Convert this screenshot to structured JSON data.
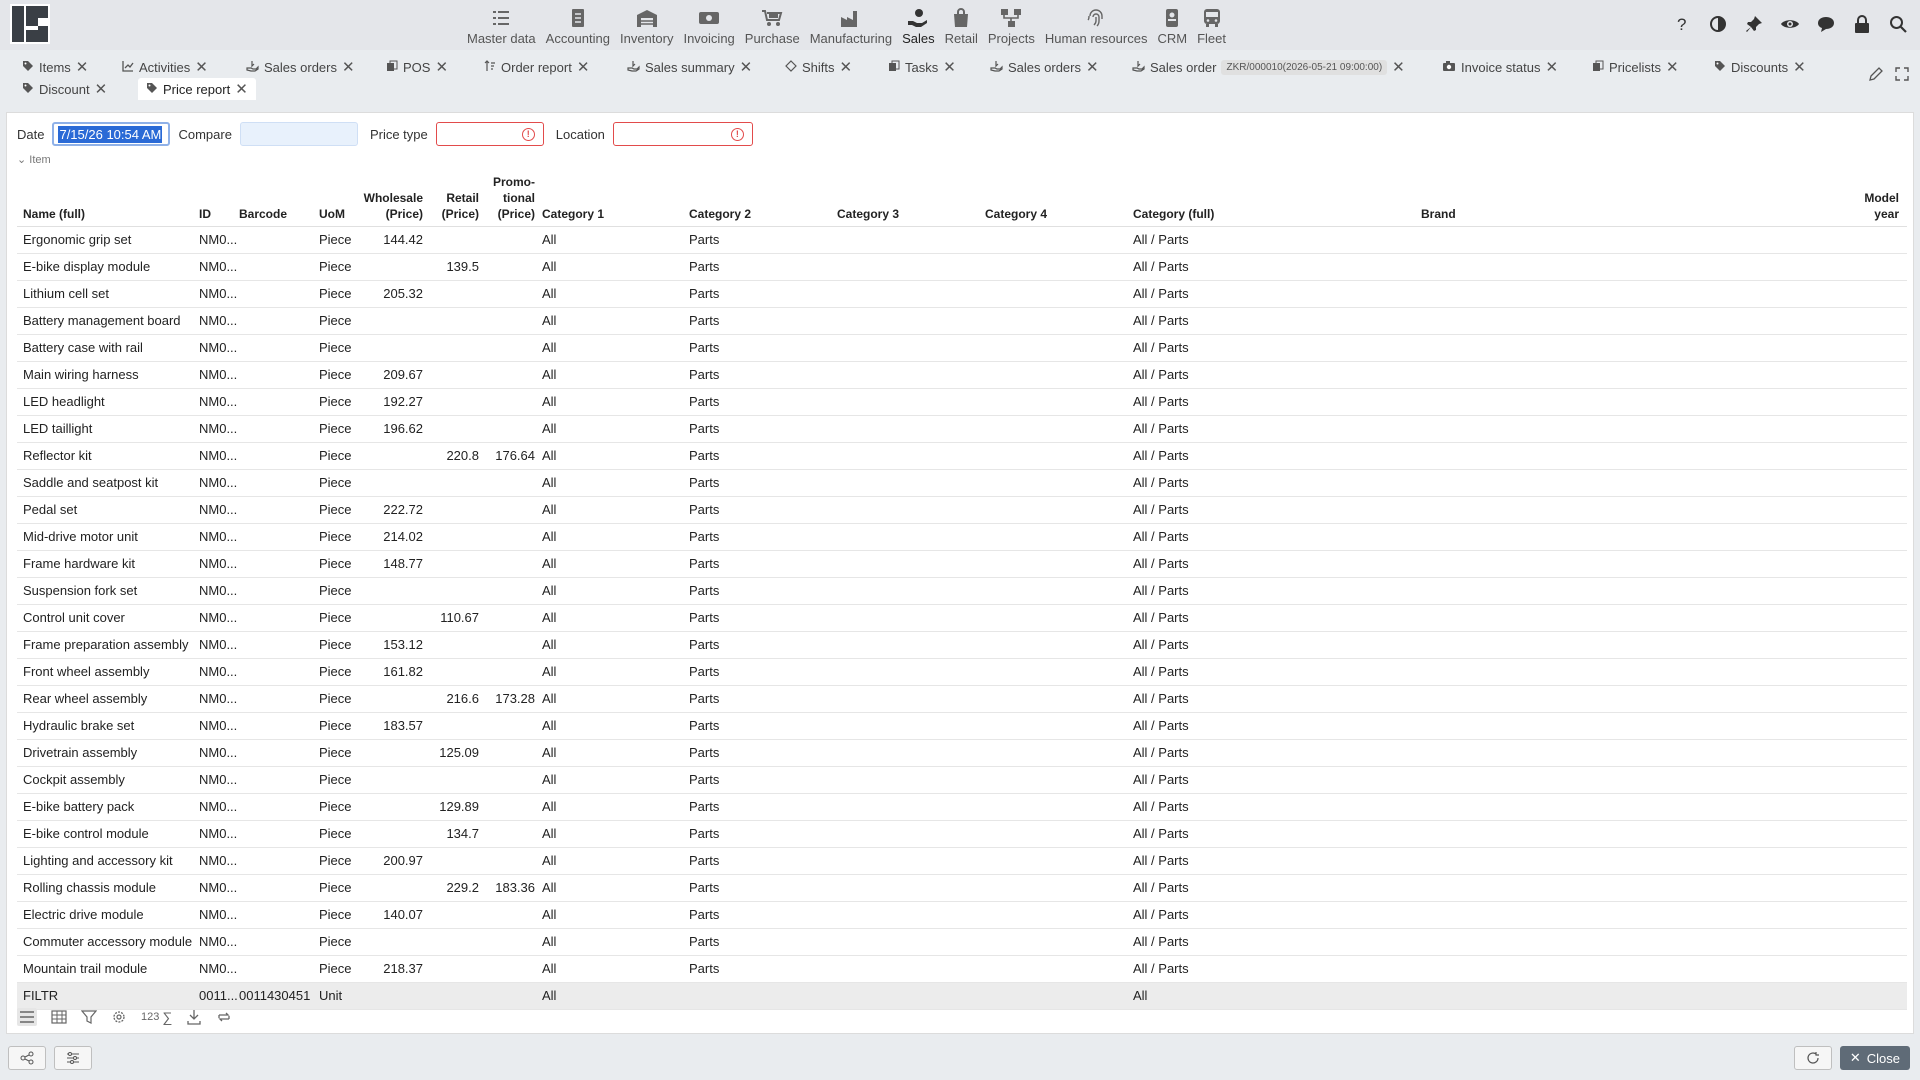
{
  "modules": [
    {
      "label": "Master data",
      "icon": "list-icon"
    },
    {
      "label": "Accounting",
      "icon": "ledger-icon"
    },
    {
      "label": "Inventory",
      "icon": "warehouse-icon"
    },
    {
      "label": "Invoicing",
      "icon": "cash-icon"
    },
    {
      "label": "Purchase",
      "icon": "cart-icon"
    },
    {
      "label": "Manufacturing",
      "icon": "factory-icon"
    },
    {
      "label": "Sales",
      "icon": "hand-coin-icon"
    },
    {
      "label": "Retail",
      "icon": "bag-icon"
    },
    {
      "label": "Projects",
      "icon": "network-icon"
    },
    {
      "label": "Human resources",
      "icon": "fingerprint-icon"
    },
    {
      "label": "CRM",
      "icon": "phone-icon"
    },
    {
      "label": "Fleet",
      "icon": "bus-icon"
    }
  ],
  "active_module": "Sales",
  "tabs": [
    {
      "label": "Items"
    },
    {
      "label": "Activities"
    },
    {
      "label": "Sales orders"
    },
    {
      "label": "POS"
    },
    {
      "label": "Order report"
    },
    {
      "label": "Sales summary"
    },
    {
      "label": "Shifts"
    },
    {
      "label": "Tasks"
    },
    {
      "label": "Sales orders"
    },
    {
      "label": "Sales order",
      "badge": "ZKR/000010(2026-05-21 09:00:00)"
    },
    {
      "label": "Invoice status"
    },
    {
      "label": "Pricelists"
    },
    {
      "label": "Discounts"
    },
    {
      "label": "Discount"
    },
    {
      "label": "Price report"
    }
  ],
  "filters": {
    "date_label": "Date",
    "date_value": "7/15/26 10:54 AM",
    "compare_label": "Compare",
    "price_type_label": "Price type",
    "location_label": "Location",
    "group_label": "Item"
  },
  "columns": [
    "Name (full)",
    "ID",
    "Barcode",
    "UoM",
    "Wholesale (Price)",
    "Retail (Price)",
    "Promo-tional (Price)",
    "Category 1",
    "Category 2",
    "Category 3",
    "Category 4",
    "Category (full)",
    "Brand",
    "Model year"
  ],
  "column_lines": {
    "wholesale": [
      "Wholesale",
      "(Price)"
    ],
    "retail": [
      "Retail",
      "(Price)"
    ],
    "promo": [
      "Promo-",
      "tional",
      "(Price)"
    ]
  },
  "rows": [
    {
      "name": "Ergonomic grip set",
      "id": "NM0...",
      "barcode": "",
      "uom": "Piece",
      "wholesale": "144.42",
      "retail": "",
      "promo": "",
      "cat1": "All",
      "cat2": "Parts",
      "catfull": "All / Parts"
    },
    {
      "name": "E-bike display module",
      "id": "NM0...",
      "barcode": "",
      "uom": "Piece",
      "wholesale": "",
      "retail": "139.5",
      "promo": "",
      "cat1": "All",
      "cat2": "Parts",
      "catfull": "All / Parts"
    },
    {
      "name": "Lithium cell set",
      "id": "NM0...",
      "barcode": "",
      "uom": "Piece",
      "wholesale": "205.32",
      "retail": "",
      "promo": "",
      "cat1": "All",
      "cat2": "Parts",
      "catfull": "All / Parts"
    },
    {
      "name": "Battery management board",
      "id": "NM0...",
      "barcode": "",
      "uom": "Piece",
      "wholesale": "",
      "retail": "",
      "promo": "",
      "cat1": "All",
      "cat2": "Parts",
      "catfull": "All / Parts"
    },
    {
      "name": "Battery case with rail",
      "id": "NM0...",
      "barcode": "",
      "uom": "Piece",
      "wholesale": "",
      "retail": "",
      "promo": "",
      "cat1": "All",
      "cat2": "Parts",
      "catfull": "All / Parts"
    },
    {
      "name": "Main wiring harness",
      "id": "NM0...",
      "barcode": "",
      "uom": "Piece",
      "wholesale": "209.67",
      "retail": "",
      "promo": "",
      "cat1": "All",
      "cat2": "Parts",
      "catfull": "All / Parts"
    },
    {
      "name": "LED headlight",
      "id": "NM0...",
      "barcode": "",
      "uom": "Piece",
      "wholesale": "192.27",
      "retail": "",
      "promo": "",
      "cat1": "All",
      "cat2": "Parts",
      "catfull": "All / Parts"
    },
    {
      "name": "LED taillight",
      "id": "NM0...",
      "barcode": "",
      "uom": "Piece",
      "wholesale": "196.62",
      "retail": "",
      "promo": "",
      "cat1": "All",
      "cat2": "Parts",
      "catfull": "All / Parts"
    },
    {
      "name": "Reflector kit",
      "id": "NM0...",
      "barcode": "",
      "uom": "Piece",
      "wholesale": "",
      "retail": "220.8",
      "promo": "176.64",
      "cat1": "All",
      "cat2": "Parts",
      "catfull": "All / Parts"
    },
    {
      "name": "Saddle and seatpost kit",
      "id": "NM0...",
      "barcode": "",
      "uom": "Piece",
      "wholesale": "",
      "retail": "",
      "promo": "",
      "cat1": "All",
      "cat2": "Parts",
      "catfull": "All / Parts"
    },
    {
      "name": "Pedal set",
      "id": "NM0...",
      "barcode": "",
      "uom": "Piece",
      "wholesale": "222.72",
      "retail": "",
      "promo": "",
      "cat1": "All",
      "cat2": "Parts",
      "catfull": "All / Parts"
    },
    {
      "name": "Mid-drive motor unit",
      "id": "NM0...",
      "barcode": "",
      "uom": "Piece",
      "wholesale": "214.02",
      "retail": "",
      "promo": "",
      "cat1": "All",
      "cat2": "Parts",
      "catfull": "All / Parts"
    },
    {
      "name": "Frame hardware kit",
      "id": "NM0...",
      "barcode": "",
      "uom": "Piece",
      "wholesale": "148.77",
      "retail": "",
      "promo": "",
      "cat1": "All",
      "cat2": "Parts",
      "catfull": "All / Parts"
    },
    {
      "name": "Suspension fork set",
      "id": "NM0...",
      "barcode": "",
      "uom": "Piece",
      "wholesale": "",
      "retail": "",
      "promo": "",
      "cat1": "All",
      "cat2": "Parts",
      "catfull": "All / Parts"
    },
    {
      "name": "Control unit cover",
      "id": "NM0...",
      "barcode": "",
      "uom": "Piece",
      "wholesale": "",
      "retail": "110.67",
      "promo": "",
      "cat1": "All",
      "cat2": "Parts",
      "catfull": "All / Parts"
    },
    {
      "name": "Frame preparation assembly",
      "id": "NM0...",
      "barcode": "",
      "uom": "Piece",
      "wholesale": "153.12",
      "retail": "",
      "promo": "",
      "cat1": "All",
      "cat2": "Parts",
      "catfull": "All / Parts"
    },
    {
      "name": "Front wheel assembly",
      "id": "NM0...",
      "barcode": "",
      "uom": "Piece",
      "wholesale": "161.82",
      "retail": "",
      "promo": "",
      "cat1": "All",
      "cat2": "Parts",
      "catfull": "All / Parts"
    },
    {
      "name": "Rear wheel assembly",
      "id": "NM0...",
      "barcode": "",
      "uom": "Piece",
      "wholesale": "",
      "retail": "216.6",
      "promo": "173.28",
      "cat1": "All",
      "cat2": "Parts",
      "catfull": "All / Parts"
    },
    {
      "name": "Hydraulic brake set",
      "id": "NM0...",
      "barcode": "",
      "uom": "Piece",
      "wholesale": "183.57",
      "retail": "",
      "promo": "",
      "cat1": "All",
      "cat2": "Parts",
      "catfull": "All / Parts"
    },
    {
      "name": "Drivetrain assembly",
      "id": "NM0...",
      "barcode": "",
      "uom": "Piece",
      "wholesale": "",
      "retail": "125.09",
      "promo": "",
      "cat1": "All",
      "cat2": "Parts",
      "catfull": "All / Parts"
    },
    {
      "name": "Cockpit assembly",
      "id": "NM0...",
      "barcode": "",
      "uom": "Piece",
      "wholesale": "",
      "retail": "",
      "promo": "",
      "cat1": "All",
      "cat2": "Parts",
      "catfull": "All / Parts"
    },
    {
      "name": "E-bike battery pack",
      "id": "NM0...",
      "barcode": "",
      "uom": "Piece",
      "wholesale": "",
      "retail": "129.89",
      "promo": "",
      "cat1": "All",
      "cat2": "Parts",
      "catfull": "All / Parts"
    },
    {
      "name": "E-bike control module",
      "id": "NM0...",
      "barcode": "",
      "uom": "Piece",
      "wholesale": "",
      "retail": "134.7",
      "promo": "",
      "cat1": "All",
      "cat2": "Parts",
      "catfull": "All / Parts"
    },
    {
      "name": "Lighting and accessory kit",
      "id": "NM0...",
      "barcode": "",
      "uom": "Piece",
      "wholesale": "200.97",
      "retail": "",
      "promo": "",
      "cat1": "All",
      "cat2": "Parts",
      "catfull": "All / Parts"
    },
    {
      "name": "Rolling chassis module",
      "id": "NM0...",
      "barcode": "",
      "uom": "Piece",
      "wholesale": "",
      "retail": "229.2",
      "promo": "183.36",
      "cat1": "All",
      "cat2": "Parts",
      "catfull": "All / Parts"
    },
    {
      "name": "Electric drive module",
      "id": "NM0...",
      "barcode": "",
      "uom": "Piece",
      "wholesale": "140.07",
      "retail": "",
      "promo": "",
      "cat1": "All",
      "cat2": "Parts",
      "catfull": "All / Parts"
    },
    {
      "name": "Commuter accessory module",
      "id": "NM0...",
      "barcode": "",
      "uom": "Piece",
      "wholesale": "",
      "retail": "",
      "promo": "",
      "cat1": "All",
      "cat2": "Parts",
      "catfull": "All / Parts"
    },
    {
      "name": "Mountain trail module",
      "id": "NM0...",
      "barcode": "",
      "uom": "Piece",
      "wholesale": "218.37",
      "retail": "",
      "promo": "",
      "cat1": "All",
      "cat2": "Parts",
      "catfull": "All / Parts"
    }
  ],
  "summary_row": {
    "name": "FILTR",
    "id": "0011...",
    "barcode": "0011430451",
    "uom": "Unit",
    "wholesale": "",
    "retail": "",
    "promo": "",
    "cat1": "All",
    "cat2": "",
    "catfull": "All"
  },
  "grid_tools": {
    "count_label": "123"
  },
  "close_label": "Close",
  "colors": {
    "accent": "#2a6ad6",
    "error": "#e24b4b",
    "close_bg": "#5f6b77"
  }
}
